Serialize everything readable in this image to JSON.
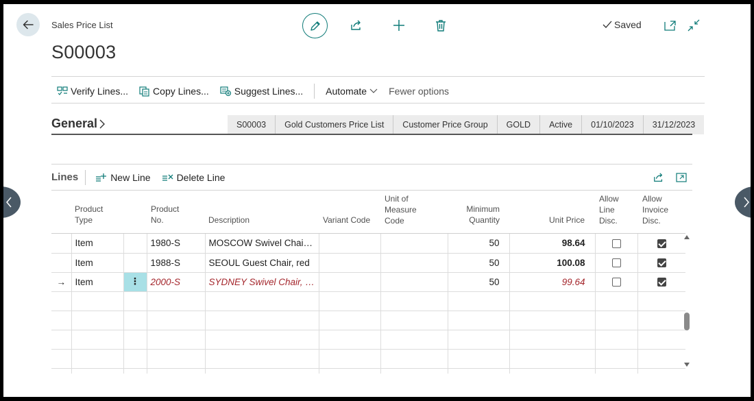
{
  "header": {
    "caption": "Sales Price List",
    "title": "S00003",
    "saved_label": "Saved"
  },
  "actions": {
    "verify": "Verify Lines...",
    "copy": "Copy Lines...",
    "suggest": "Suggest Lines...",
    "automate": "Automate",
    "fewer": "Fewer options"
  },
  "general": {
    "label": "General",
    "summary": [
      "S00003",
      "Gold Customers Price List",
      "Customer Price Group",
      "GOLD",
      "Active",
      "01/10/2023",
      "31/12/2023"
    ]
  },
  "lines": {
    "title": "Lines",
    "new_line": "New Line",
    "delete_line": "Delete Line",
    "columns": {
      "product_type": "Product Type",
      "product_no": "Product No.",
      "description": "Description",
      "variant_code": "Variant Code",
      "uom_code": "Unit of Measure Code",
      "min_qty": "Minimum Quantity",
      "unit_price": "Unit Price",
      "allow_line_disc": "Allow Line Disc.",
      "allow_invoice_disc": "Allow Invoice Disc."
    },
    "rows": [
      {
        "type": "Item",
        "no": "1980-S",
        "desc": "MOSCOW Swivel Chair, red",
        "qty": "50",
        "price": "98.64",
        "line_disc": false,
        "inv_disc": true
      },
      {
        "type": "Item",
        "no": "1988-S",
        "desc": "SEOUL Guest Chair, red",
        "qty": "50",
        "price": "100.08",
        "line_disc": false,
        "inv_disc": true
      },
      {
        "type": "Item",
        "no": "2000-S",
        "desc": "SYDNEY Swivel Chair, green",
        "qty": "50",
        "price": "99.64",
        "line_disc": false,
        "inv_disc": true
      }
    ],
    "selected_marker": "→",
    "kebab": "⋮"
  },
  "colors": {
    "accent": "#0f7b78",
    "error_text": "#a4262c",
    "summary_bg": "#ececec",
    "kebab_bg": "#a8e0e6"
  }
}
